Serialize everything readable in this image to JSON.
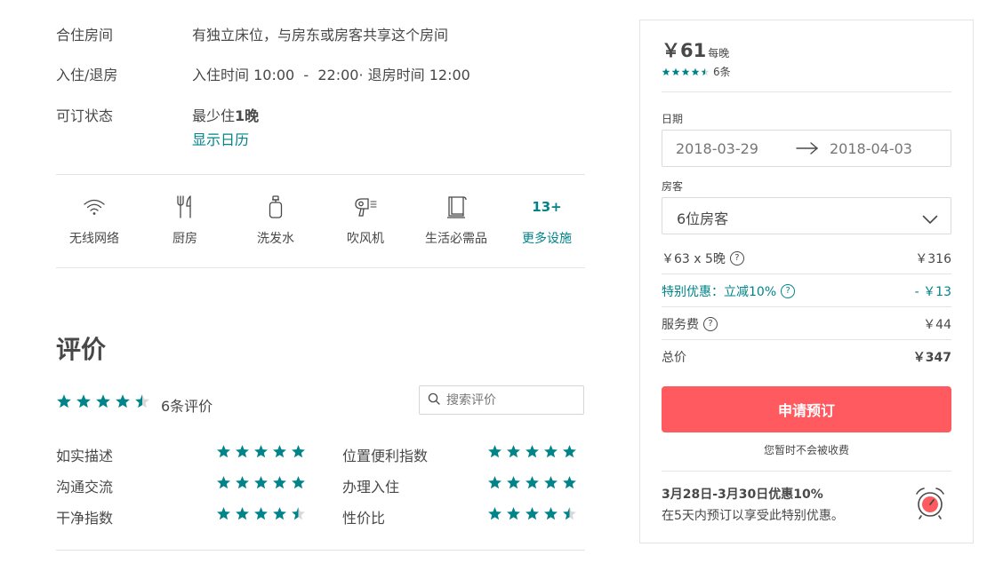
{
  "details": {
    "room_type_label": "合住房间",
    "room_type_value": "有独立床位，与房东或房客共享这个房间",
    "checkin_label": "入住/退房",
    "checkin_text": "入住时间 ",
    "checkin_from": "10:00",
    "checkin_sep": "  -  ",
    "checkin_to": "22:00",
    "checkout_text": "· 退房时间 ",
    "checkout_time": "12:00",
    "availability_label": "可订状态",
    "min_stay_prefix": "最少住",
    "min_stay_value": "1晚",
    "calendar_link": "显示日历"
  },
  "amenities": {
    "items": [
      {
        "label": "无线网络",
        "icon": "wifi-icon"
      },
      {
        "label": "厨房",
        "icon": "kitchen-icon"
      },
      {
        "label": "洗发水",
        "icon": "shampoo-icon"
      },
      {
        "label": "吹风机",
        "icon": "hair-dryer-icon"
      },
      {
        "label": "生活必需品",
        "icon": "essentials-icon"
      }
    ],
    "more_count": "13+",
    "more_label": "更多设施"
  },
  "reviews": {
    "title": "评价",
    "overall_rating": 4.5,
    "count_label": "6条评价",
    "search_placeholder": "搜索评价",
    "categories": [
      {
        "label": "如实描述",
        "rating": 5
      },
      {
        "label": "位置便利指数",
        "rating": 5
      },
      {
        "label": "沟通交流",
        "rating": 5
      },
      {
        "label": "办理入住",
        "rating": 5
      },
      {
        "label": "干净指数",
        "rating": 4.5
      },
      {
        "label": "性价比",
        "rating": 4.5
      }
    ]
  },
  "booking": {
    "price": "￥61",
    "price_unit": "每晚",
    "rating": 4.5,
    "review_count": "6条",
    "date_label": "日期",
    "checkin_date": "2018-03-29",
    "checkout_date": "2018-04-03",
    "guests_label": "房客",
    "guests_value": "6位房客",
    "line_items": [
      {
        "label": "￥63 x 5晚",
        "value": "￥316",
        "help": true,
        "highlight": false
      },
      {
        "label": "特别优惠：立减10%",
        "value": "- ￥13",
        "help": true,
        "highlight": true
      },
      {
        "label": "服务费",
        "value": "￥44",
        "help": true,
        "highlight": false
      }
    ],
    "total_label": "总价",
    "total_value": "￥347",
    "book_button": "申请预订",
    "no_charge_note": "您暂时不会被收费",
    "promo_title": "3月28日-3月30日优惠10%",
    "promo_desc": "在5天内预订以享受此特别优惠。"
  },
  "colors": {
    "accent": "#008489",
    "star": "#008489",
    "book_button": "#ff5a5f",
    "text": "#484848"
  }
}
